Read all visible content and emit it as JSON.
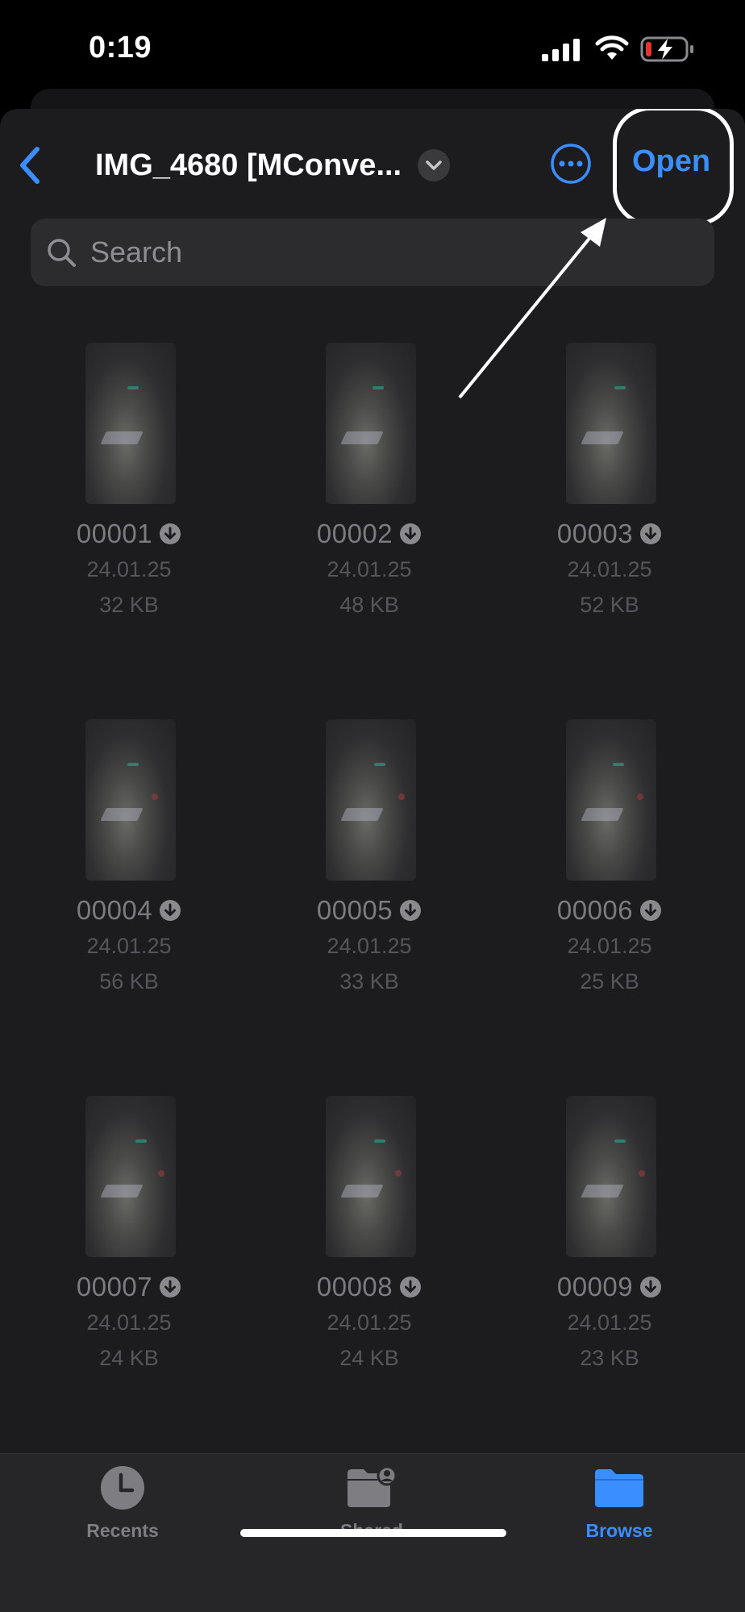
{
  "status": {
    "time": "0:19",
    "icons": [
      "cellular-signal-icon",
      "wifi-icon",
      "battery-charging-icon"
    ],
    "battery_low_color": "#e5352b"
  },
  "nav": {
    "title": "IMG_4680 [MConve...",
    "open_label": "Open",
    "icons": {
      "back": "chevron-left-icon",
      "title_menu": "chevron-down-icon",
      "more": "ellipsis-circle-icon"
    }
  },
  "search": {
    "placeholder": "Search"
  },
  "files": [
    {
      "name": "00001",
      "date": "24.01.25",
      "size": "32 KB"
    },
    {
      "name": "00002",
      "date": "24.01.25",
      "size": "48 KB"
    },
    {
      "name": "00003",
      "date": "24.01.25",
      "size": "52 KB"
    },
    {
      "name": "00004",
      "date": "24.01.25",
      "size": "56 KB"
    },
    {
      "name": "00005",
      "date": "24.01.25",
      "size": "33 KB"
    },
    {
      "name": "00006",
      "date": "24.01.25",
      "size": "25 KB"
    },
    {
      "name": "00007",
      "date": "24.01.25",
      "size": "24 KB"
    },
    {
      "name": "00008",
      "date": "24.01.25",
      "size": "24 KB"
    },
    {
      "name": "00009",
      "date": "24.01.25",
      "size": "23 KB"
    }
  ],
  "tabs": [
    {
      "label": "Recents",
      "icon": "clock-icon",
      "active": false
    },
    {
      "label": "Shared",
      "icon": "shared-folder-icon",
      "active": false
    },
    {
      "label": "Browse",
      "icon": "folder-icon",
      "active": true
    }
  ],
  "colors": {
    "accent": "#3a8eff",
    "background": "#1c1c1e",
    "tab_inactive": "#7d7d82"
  }
}
